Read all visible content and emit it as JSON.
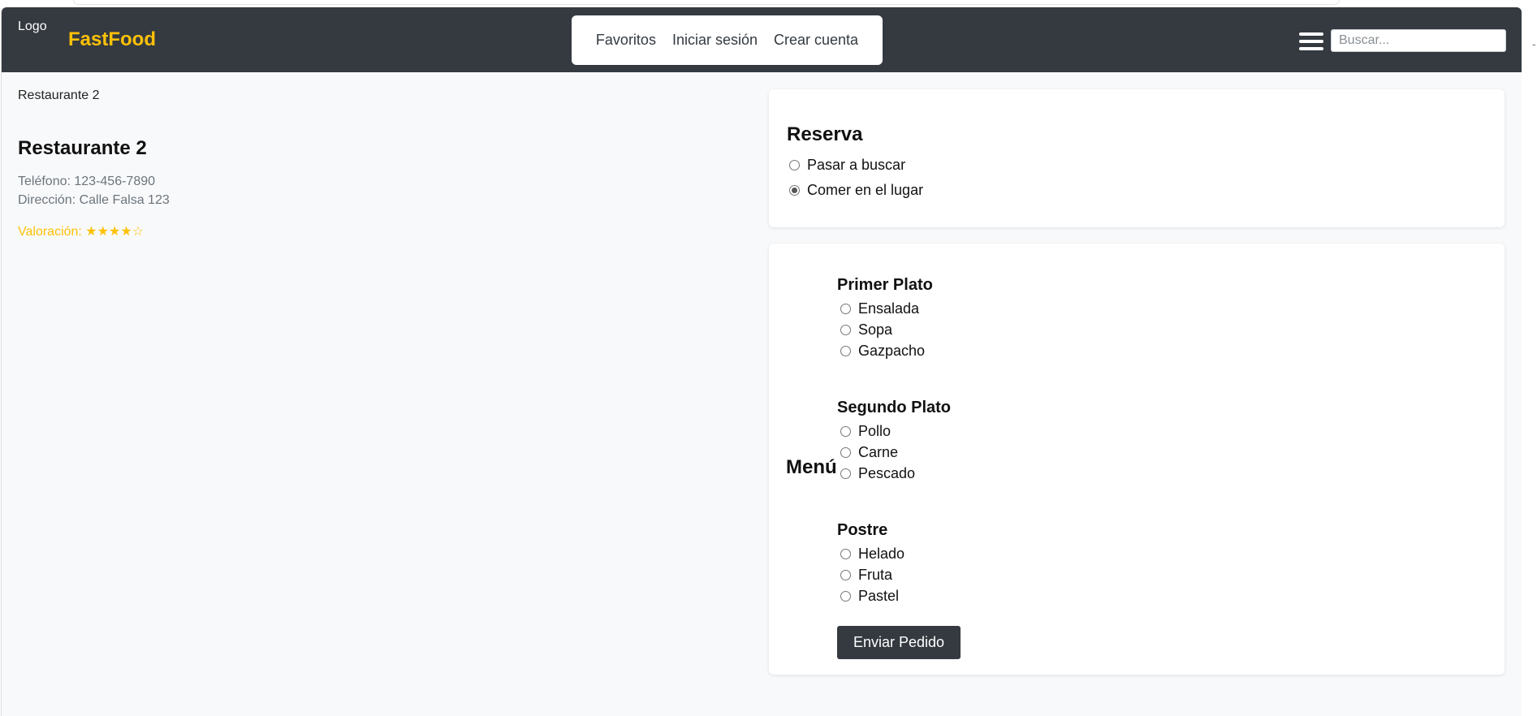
{
  "header": {
    "logo_alt": "Logo",
    "brand": "FastFood",
    "nav": [
      "Favoritos",
      "Iniciar sesión",
      "Crear cuenta"
    ],
    "search_placeholder": "Buscar...",
    "menu_icon": "hamburger-icon"
  },
  "restaurant": {
    "image_alt": "Restaurante 2",
    "name": "Restaurante 2",
    "phone": "Teléfono: 123-456-7890",
    "address": "Dirección: Calle Falsa 123",
    "rating": "Valoración: ★★★★☆"
  },
  "reserva": {
    "title": "Reserva",
    "options": [
      {
        "label": "Pasar a buscar",
        "checked": false
      },
      {
        "label": "Comer en el lugar",
        "checked": true
      }
    ]
  },
  "menu": {
    "title": "Menú",
    "courses": [
      {
        "title": "Primer Plato",
        "options": [
          "Ensalada",
          "Sopa",
          "Gazpacho"
        ]
      },
      {
        "title": "Segundo Plato",
        "options": [
          "Pollo",
          "Carne",
          "Pescado"
        ]
      },
      {
        "title": "Postre",
        "options": [
          "Helado",
          "Fruta",
          "Pastel"
        ]
      }
    ],
    "submit_label": "Enviar Pedido"
  },
  "colors": {
    "navbar": "#343a40",
    "brand": "#ffc107",
    "page_bg": "#f8f9fa",
    "muted_text": "#6c757d",
    "rating": "#ffc107"
  }
}
